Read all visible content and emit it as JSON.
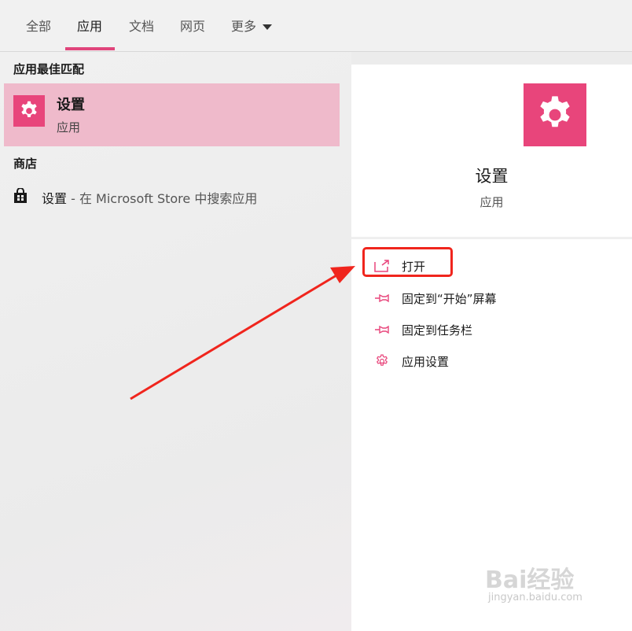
{
  "tabs": [
    {
      "label": "全部"
    },
    {
      "label": "应用"
    },
    {
      "label": "文档"
    },
    {
      "label": "网页"
    },
    {
      "label": "更多"
    }
  ],
  "left": {
    "best_match_heading": "应用最佳匹配",
    "best_match": {
      "title": "设置",
      "subtitle": "应用",
      "icon": "gear-icon"
    },
    "store_heading": "商店",
    "store_item": {
      "title": "设置",
      "suffix": " - 在 Microsoft Store 中搜索应用",
      "icon": "store-bag-icon"
    }
  },
  "right": {
    "app_title": "设置",
    "app_subtitle": "应用",
    "actions": [
      {
        "label": "打开",
        "icon": "open-icon"
      },
      {
        "label": "固定到“开始”屏幕",
        "icon": "pin-icon"
      },
      {
        "label": "固定到任务栏",
        "icon": "pin-icon"
      },
      {
        "label": "应用设置",
        "icon": "gear-outline-icon"
      }
    ]
  },
  "watermark": {
    "brand": "Bai经验",
    "url": "jingyan.baidu.com"
  },
  "colors": {
    "accent": "#e8457b",
    "highlight": "#efbacb",
    "annotation": "#f0251d"
  }
}
